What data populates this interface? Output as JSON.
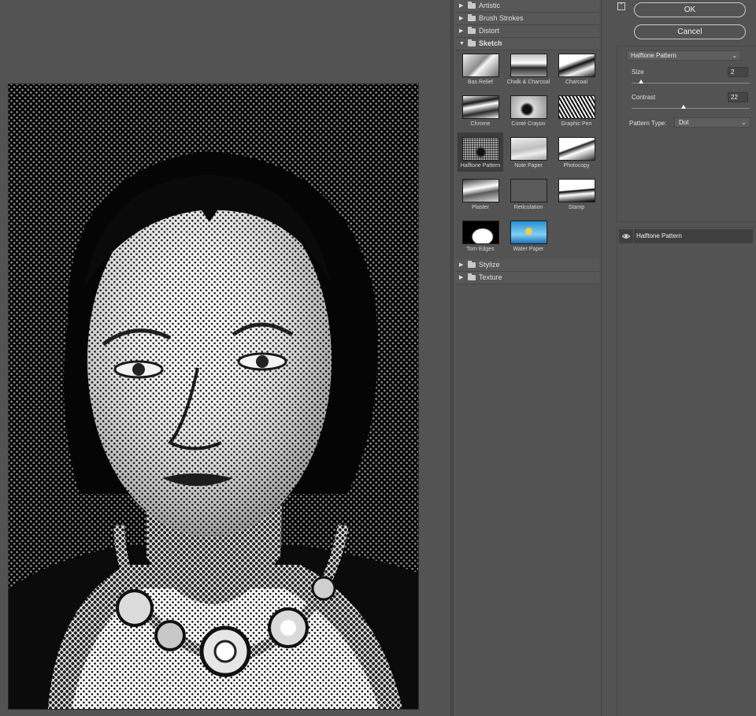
{
  "gallery": {
    "categories_top": [
      {
        "label": "Artistic",
        "expanded": false
      },
      {
        "label": "Brush Strokes",
        "expanded": false
      },
      {
        "label": "Distort",
        "expanded": false
      },
      {
        "label": "Sketch",
        "expanded": true
      }
    ],
    "sketch_filters": [
      {
        "label": "Bas Relief",
        "selected": false
      },
      {
        "label": "Chalk & Charcoal",
        "selected": false
      },
      {
        "label": "Charcoal",
        "selected": false
      },
      {
        "label": "Chrome",
        "selected": false
      },
      {
        "label": "Conté Crayon",
        "selected": false
      },
      {
        "label": "Graphic Pen",
        "selected": false
      },
      {
        "label": "Halftone Pattern",
        "selected": true
      },
      {
        "label": "Note Paper",
        "selected": false
      },
      {
        "label": "Photocopy",
        "selected": false
      },
      {
        "label": "Plaster",
        "selected": false
      },
      {
        "label": "Reticulation",
        "selected": false
      },
      {
        "label": "Stamp",
        "selected": false
      },
      {
        "label": "Torn Edges",
        "selected": false
      },
      {
        "label": "Water Paper",
        "selected": false
      }
    ],
    "categories_bottom": [
      {
        "label": "Stylize",
        "expanded": false
      },
      {
        "label": "Texture",
        "expanded": false
      }
    ]
  },
  "settings": {
    "ok_label": "OK",
    "cancel_label": "Cancel",
    "filter_select": "Halftone Pattern",
    "size_label": "Size",
    "size_value": "2",
    "size_fraction": 0.08,
    "contrast_label": "Contrast",
    "contrast_value": "22",
    "contrast_fraction": 0.44,
    "pattern_type_label": "Pattern Type:",
    "pattern_type_value": "Dot"
  },
  "layers": {
    "active_layer": "Halftone Pattern"
  },
  "colors": {
    "background": "#535353",
    "selected_thumb": "#3c3c3c",
    "layer_row": "#3f3f3f"
  },
  "icons": {
    "collapse": "collapse-panel-icon",
    "visibility": "eye-icon",
    "folder": "folder-icon",
    "disclosure": "disclosure-triangle-icon"
  }
}
